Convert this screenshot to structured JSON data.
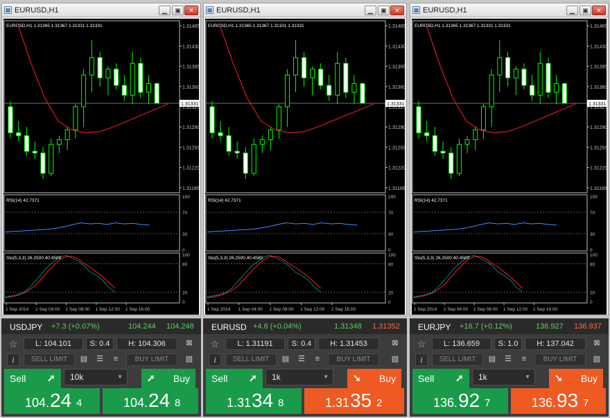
{
  "windows": [
    {
      "title": "EURUSD,H1",
      "chart_label": "EURUSD,H1 1.31365 1.31367 1.31331 1.31331",
      "current_price": "1.31331",
      "price_ticks": [
        "1.31465",
        "1.31430",
        "1.31395",
        "1.31360",
        "1.31325",
        "1.31290",
        "1.31255",
        "1.31220",
        "1.31185"
      ],
      "rsi_label": "RSI(14) 42.7371",
      "rsi_levels": [
        "100",
        "70",
        "30",
        "0"
      ],
      "stoch_label": "Sto(5,3,3) 26.2500 40.4589",
      "stoch_levels": [
        "100",
        "80",
        "20",
        "0"
      ],
      "time_ticks": [
        "1 Sep 2014",
        "1 Sep 04:00",
        "1 Sep 08:00",
        "1 Sep 12:00",
        "1 Sep 16:00"
      ]
    },
    {
      "title": "EURUSD,H1",
      "chart_label": "EURUSD,H1 1.31365 1.31367 1.31331 1.31331",
      "current_price": "1.31331",
      "price_ticks": [
        "1.31465",
        "1.31430",
        "1.31395",
        "1.31360",
        "1.31325",
        "1.31290",
        "1.31255",
        "1.31220",
        "1.31185"
      ],
      "rsi_label": "RSI(14) 42.7371",
      "rsi_levels": [
        "100",
        "70",
        "30",
        "0"
      ],
      "stoch_label": "Sto(5,3,3) 26.2500 40.4589",
      "stoch_levels": [
        "100",
        "80",
        "20",
        "0"
      ],
      "time_ticks": [
        "1 Sep 2014",
        "1 Sep 04:00",
        "1 Sep 08:00",
        "1 Sep 12:00",
        "1 Sep 16:00"
      ]
    },
    {
      "title": "EURUSD,H1",
      "chart_label": "EURUSD,H1 1.31365 1.31367 1.31331 1.31331",
      "current_price": "1.31331",
      "price_ticks": [
        "1.31465",
        "1.31430",
        "1.31395",
        "1.31360",
        "1.31325",
        "1.31290",
        "1.31255",
        "1.31220",
        "1.31185"
      ],
      "rsi_label": "RSI(14) 42.7371",
      "rsi_levels": [
        "100",
        "70",
        "30",
        "0"
      ],
      "stoch_label": "Sto(5,3,3) 26.2500 40.4589",
      "stoch_levels": [
        "100",
        "80",
        "20",
        "0"
      ],
      "time_ticks": [
        "1 Sep 2014",
        "1 Sep 04:00",
        "1 Sep 08:00",
        "1 Sep 12:00",
        "1 Sep 16:00"
      ]
    }
  ],
  "candles_style": {
    "bull": "#00ff00",
    "bear": "#ffffff",
    "ma": "#ff2020",
    "rsi": "#3a8fff",
    "stoch_main": "#00c0c0",
    "stoch_signal": "#ff2020"
  },
  "candles": [
    {
      "o": 1.31325,
      "h": 1.31335,
      "l": 1.3127,
      "c": 1.3128
    },
    {
      "o": 1.3128,
      "h": 1.313,
      "l": 1.31265,
      "c": 1.31275
    },
    {
      "o": 1.31275,
      "h": 1.3129,
      "l": 1.3124,
      "c": 1.31248
    },
    {
      "o": 1.31248,
      "h": 1.31265,
      "l": 1.31235,
      "c": 1.31245
    },
    {
      "o": 1.31245,
      "h": 1.31255,
      "l": 1.312,
      "c": 1.3121
    },
    {
      "o": 1.3121,
      "h": 1.3127,
      "l": 1.31205,
      "c": 1.3126
    },
    {
      "o": 1.3126,
      "h": 1.31275,
      "l": 1.31245,
      "c": 1.31268
    },
    {
      "o": 1.31268,
      "h": 1.3129,
      "l": 1.3125,
      "c": 1.31285
    },
    {
      "o": 1.31285,
      "h": 1.3133,
      "l": 1.3127,
      "c": 1.31325
    },
    {
      "o": 1.31325,
      "h": 1.3139,
      "l": 1.3129,
      "c": 1.3138
    },
    {
      "o": 1.3138,
      "h": 1.3144,
      "l": 1.3135,
      "c": 1.3141
    },
    {
      "o": 1.3141,
      "h": 1.3142,
      "l": 1.3136,
      "c": 1.31375
    },
    {
      "o": 1.31375,
      "h": 1.31395,
      "l": 1.31345,
      "c": 1.3139
    },
    {
      "o": 1.3139,
      "h": 1.314,
      "l": 1.31355,
      "c": 1.31362
    },
    {
      "o": 1.31362,
      "h": 1.3138,
      "l": 1.31335,
      "c": 1.31345
    },
    {
      "o": 1.31345,
      "h": 1.3142,
      "l": 1.3133,
      "c": 1.314
    },
    {
      "o": 1.314,
      "h": 1.3141,
      "l": 1.3134,
      "c": 1.3135
    },
    {
      "o": 1.3135,
      "h": 1.3138,
      "l": 1.3133,
      "c": 1.31365
    },
    {
      "o": 1.31365,
      "h": 1.31367,
      "l": 1.31331,
      "c": 1.31331
    }
  ],
  "panels": [
    {
      "symbol": "USDJPY",
      "change": "+7.3 (+0.07%)",
      "bid_top": "104.244",
      "ask_top": "104.248",
      "ask_color": "#5fcf5f",
      "low": "L: 104.101",
      "spread": "S: 0.4",
      "high": "H: 104.306",
      "sell_limit": "SELL LIMIT",
      "buy_limit": "BUY LIMIT",
      "sell": "Sell",
      "buy": "Buy",
      "lot": "10k",
      "buy_color": "#1a9b4a",
      "bid_prefix": "104.",
      "bid_big": "24",
      "bid_pip": "4",
      "ask_prefix": "104.",
      "ask_big": "24",
      "ask_pip": "8"
    },
    {
      "symbol": "EURUSD",
      "change": "+4.6 (+0.04%)",
      "bid_top": "1.31348",
      "ask_top": "1.31352",
      "ask_color": "#ff6a3a",
      "low": "L: 1.31191",
      "spread": "S: 0.4",
      "high": "H: 1.31453",
      "sell_limit": "SELL LIMIT",
      "buy_limit": "BUY LIMIT",
      "sell": "Sell",
      "buy": "Buy",
      "lot": "1k",
      "buy_color": "#ef5a22",
      "bid_prefix": "1.31",
      "bid_big": "34",
      "bid_pip": "8",
      "ask_prefix": "1.31",
      "ask_big": "35",
      "ask_pip": "2"
    },
    {
      "symbol": "EURJPY",
      "change": "+16.7 (+0.12%)",
      "bid_top": "136.927",
      "ask_top": "136.937",
      "ask_color": "#ff6a3a",
      "low": "L: 136.659",
      "spread": "S: 1.0",
      "high": "H: 137.042",
      "sell_limit": "SELL LIMIT",
      "buy_limit": "BUY LIMIT",
      "sell": "Sell",
      "buy": "Buy",
      "lot": "1k",
      "buy_color": "#ef5a22",
      "bid_prefix": "136.",
      "bid_big": "92",
      "bid_pip": "7",
      "ask_prefix": "136.",
      "ask_big": "93",
      "ask_pip": "7"
    }
  ],
  "icons": {
    "star": "star-icon",
    "chart": "chart-icon",
    "info": "info-icon",
    "grid1": "depth-icon",
    "grid2": "list-icon",
    "grid3": "ladder-icon",
    "notes": "notes-icon",
    "arrow_up": "arrow-up-right-icon",
    "arrow_down": "arrow-down-right-icon"
  }
}
